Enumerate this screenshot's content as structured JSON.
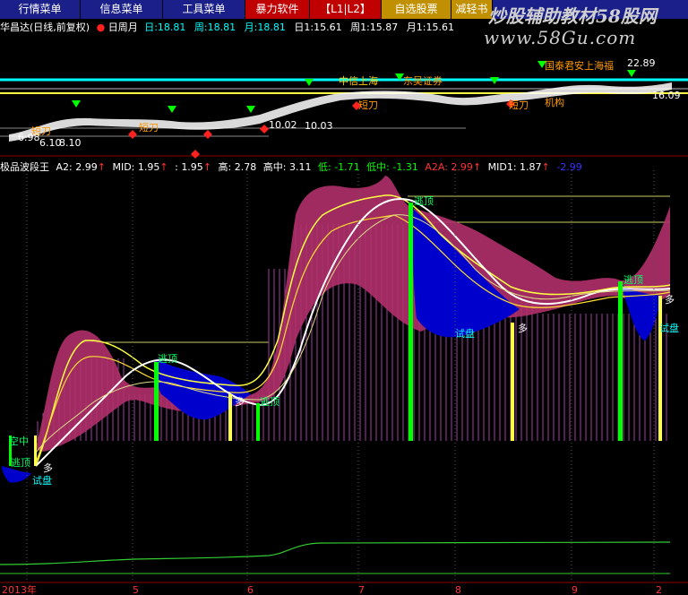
{
  "menu": [
    {
      "label": "行情菜单",
      "bg": "#1a1f8a",
      "color": "#ffffff"
    },
    {
      "label": "信息菜单",
      "bg": "#1a1f8a",
      "color": "#ffffff"
    },
    {
      "label": "工具菜单",
      "bg": "#1a1f8a",
      "color": "#ffffff"
    },
    {
      "label": "暴力软件",
      "bg": "#c00000",
      "color": "#ffffff"
    },
    {
      "label": "【L1|L2】",
      "bg": "#c00000",
      "color": "#ffffff"
    },
    {
      "label": "自选股票",
      "bg": "#c09000",
      "color": "#ffffff"
    },
    {
      "label": "减轻书",
      "bg": "#c09000",
      "color": "#ffffff"
    }
  ],
  "watermark": {
    "line1": "炒股辅助教材58股网",
    "line2": "www.58Gu.com"
  },
  "upper_panel": {
    "title": "华昌达(日线,前复权)",
    "period_label": "日周月",
    "values": [
      {
        "label": "日:",
        "value": "18.81",
        "color": "#00ffff"
      },
      {
        "label": "周:",
        "value": "18.81",
        "color": "#00ffff"
      },
      {
        "label": "月:",
        "value": "18.81",
        "color": "#00ffff"
      },
      {
        "label": "日1:",
        "value": "15.61",
        "color": "#ffffff"
      },
      {
        "label": "周1:",
        "value": "15.87",
        "color": "#ffffff"
      },
      {
        "label": "月1:",
        "value": "15.61",
        "color": "#ffffff"
      }
    ],
    "annotations": [
      "中信上海",
      "东吴证券",
      "国泰君安上海福",
      "22.89",
      "短刀",
      "短刀",
      "短刀",
      "短刀",
      "机构",
      "10.02",
      "10.03",
      "6.98",
      "6.10",
      "8.10",
      "16.09"
    ]
  },
  "lower_panel": {
    "title": "极品波段王",
    "indicators": [
      {
        "label": "A2:",
        "value": "2.99",
        "arrow": "↑",
        "color": "#ffffff"
      },
      {
        "label": "MID:",
        "value": "1.95",
        "arrow": "↑",
        "color": "#ffffff"
      },
      {
        "label": ":",
        "value": "1.95",
        "arrow": "↑",
        "color": "#ffffff"
      },
      {
        "label": "高:",
        "value": "2.78",
        "arrow": "",
        "color": "#ffffff"
      },
      {
        "label": "高中:",
        "value": "3.11",
        "arrow": "",
        "color": "#ffffff"
      },
      {
        "label": "低:",
        "value": "-1.71",
        "arrow": "",
        "color": "#00ff00"
      },
      {
        "label": "低中:",
        "value": "-1.31",
        "arrow": "",
        "color": "#00ff00"
      },
      {
        "label": "A2A:",
        "value": "2.99",
        "arrow": "↑",
        "color": "#ff3333"
      },
      {
        "label": "MID1:",
        "value": "1.87",
        "arrow": "↑",
        "color": "#ffffff"
      },
      {
        "label": "",
        "value": "-2.99",
        "arrow": "",
        "color": "#3333ff"
      }
    ],
    "signals": [
      "逃顶",
      "逃顶",
      "逃顶",
      "逃顶",
      "逃顶",
      "多",
      "多",
      "多",
      "多",
      "试盘",
      "试盘",
      "试盘",
      "空中",
      "逃顶"
    ]
  },
  "x_axis": {
    "labels": [
      "2013年",
      "5",
      "6",
      "7",
      "8",
      "9",
      "2"
    ]
  },
  "colors": {
    "accent_cyan": "#00ffff",
    "magenta": "#c0306a",
    "blue": "#0000cc",
    "green": "#00ff00",
    "yellow": "#ffff44",
    "grid": "#8b0000"
  }
}
